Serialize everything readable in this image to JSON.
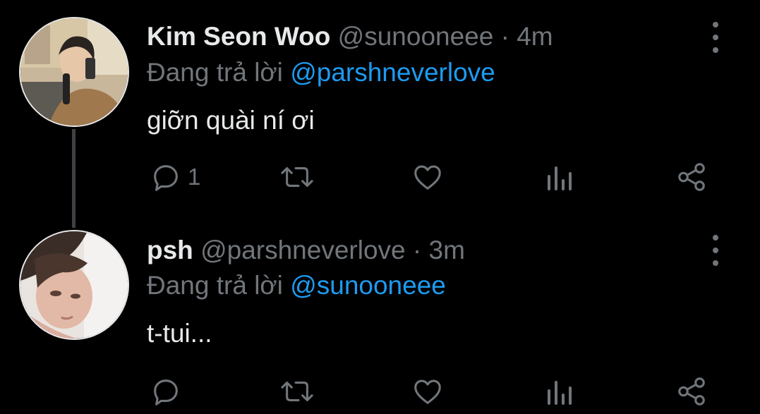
{
  "colors": {
    "background": "#000000",
    "text": "#e7e9ea",
    "secondary": "#71767b",
    "accent": "#1d9bf0",
    "thread_line": "#3e4144"
  },
  "tweets": [
    {
      "display_name": "Kim Seon Woo",
      "handle": "@sunooneee",
      "separator": "·",
      "time": "4m",
      "reply_prefix": "Đang trả lời",
      "reply_to": "@parshneverlove",
      "text": "giỡn quài ní ơi",
      "reply_count": "1",
      "avatar_icon": "profile-photo"
    },
    {
      "display_name": "psh",
      "handle": "@parshneverlove",
      "separator": "·",
      "time": "3m",
      "reply_prefix": "Đang trả lời",
      "reply_to": "@sunooneee",
      "text": "t-tui...",
      "reply_count": "",
      "avatar_icon": "profile-photo"
    }
  ],
  "action_icons": [
    "reply-icon",
    "retweet-icon",
    "like-icon",
    "analytics-icon",
    "share-icon"
  ]
}
